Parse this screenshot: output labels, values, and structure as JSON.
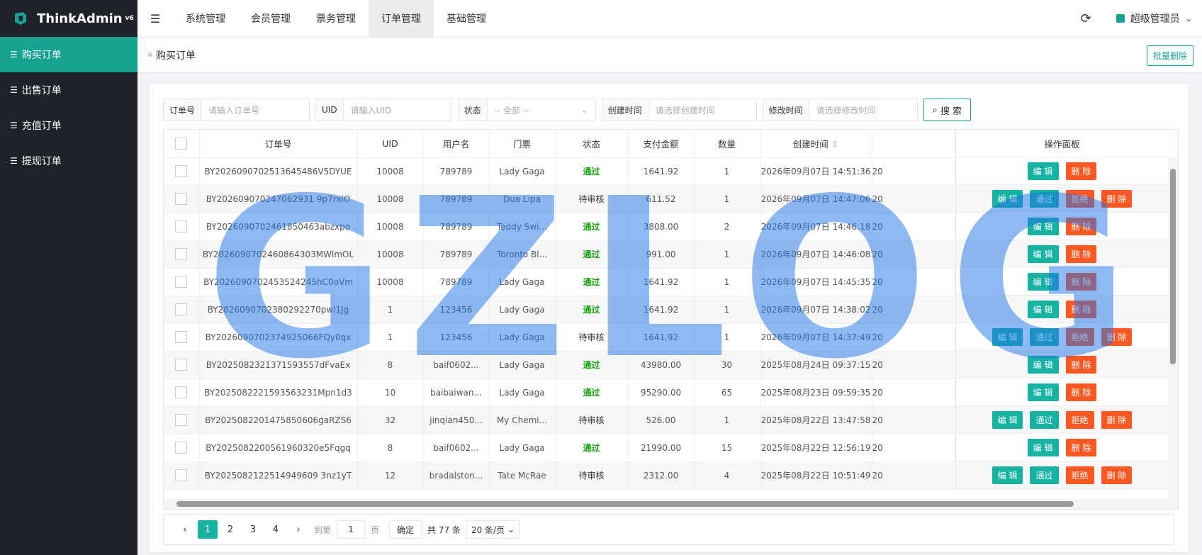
{
  "brand": {
    "name": "ThinkAdmin",
    "version": "v6"
  },
  "sidebar": {
    "items": [
      {
        "label": "购买订单",
        "active": true
      },
      {
        "label": "出售订单",
        "active": false
      },
      {
        "label": "充值订单",
        "active": false
      },
      {
        "label": "提现订单",
        "active": false
      }
    ]
  },
  "topnav": {
    "items": [
      {
        "label": "系统管理"
      },
      {
        "label": "会员管理"
      },
      {
        "label": "票务管理"
      },
      {
        "label": "订单管理",
        "active": true
      },
      {
        "label": "基础管理"
      }
    ],
    "user": "超级管理员"
  },
  "breadcrumb": {
    "title": "购买订单",
    "batch_delete": "批量删除"
  },
  "filters": {
    "order_no": {
      "label": "订单号",
      "placeholder": "请输入订单号"
    },
    "uid": {
      "label": "UID",
      "placeholder": "请输入UID"
    },
    "status": {
      "label": "状态",
      "value": "-- 全部 --"
    },
    "created": {
      "label": "创建时间",
      "placeholder": "请选择创建时间"
    },
    "modified": {
      "label": "修改时间",
      "placeholder": "请选择修改时间"
    },
    "search": "搜 索"
  },
  "table": {
    "headers": {
      "order_no": "订单号",
      "uid": "UID",
      "user": "用户名",
      "ticket": "门票",
      "status": "状态",
      "amount": "支付金额",
      "qty": "数量",
      "created": "创建时间",
      "ops": "操作面板"
    },
    "rows": [
      {
        "order_no": "BY2026090702513645486V5DYUE",
        "uid": "10008",
        "user": "789789",
        "ticket": "Lady Gaga",
        "status": "通过",
        "amount": "1641.92",
        "qty": "1",
        "created": "2026年09月07日 14:51:36",
        "more": "20"
      },
      {
        "order_no": "BY202609070247062931 9p7rxiO",
        "uid": "10008",
        "user": "789789",
        "ticket": "Dua Lipa",
        "status": "待审核",
        "amount": "611.52",
        "qty": "1",
        "created": "2026年09月07日 14:47:06",
        "more": "20"
      },
      {
        "order_no": "BY2026090702461850463abzxpo",
        "uid": "10008",
        "user": "789789",
        "ticket": "Teddy Swi...",
        "status": "通过",
        "amount": "3808.00",
        "qty": "2",
        "created": "2026年09月07日 14:46:18",
        "more": "20"
      },
      {
        "order_no": "BY2026090702460864303MWlmOL",
        "uid": "10008",
        "user": "789789",
        "ticket": "Toronto Bl...",
        "status": "通过",
        "amount": "991.00",
        "qty": "1",
        "created": "2026年09月07日 14:46:08",
        "more": "20"
      },
      {
        "order_no": "BY2026090702453524245hC0oVm",
        "uid": "10008",
        "user": "789789",
        "ticket": "Lady Gaga",
        "status": "通过",
        "amount": "1641.92",
        "qty": "1",
        "created": "2026年09月07日 14:45:35",
        "more": "20"
      },
      {
        "order_no": "BY2026090702380292270pwl1Jg",
        "uid": "1",
        "user": "123456",
        "ticket": "Lady Gaga",
        "status": "通过",
        "amount": "1641.92",
        "qty": "1",
        "created": "2026年09月07日 14:38:02",
        "more": "20"
      },
      {
        "order_no": "BY2026090702374925066FQy0qx",
        "uid": "1",
        "user": "123456",
        "ticket": "Lady Gaga",
        "status": "待审核",
        "amount": "1641.92",
        "qty": "1",
        "created": "2026年09月07日 14:37:49",
        "more": "20"
      },
      {
        "order_no": "BY2025082321371593557dFvaEx",
        "uid": "8",
        "user": "baif0602...",
        "ticket": "Lady Gaga",
        "status": "通过",
        "amount": "43980.00",
        "qty": "30",
        "created": "2025年08月24日 09:37:15",
        "more": "20"
      },
      {
        "order_no": "BY2025082221593563231Mpn1d3",
        "uid": "10",
        "user": "baibaiwan...",
        "ticket": "Lady Gaga",
        "status": "通过",
        "amount": "95290.00",
        "qty": "65",
        "created": "2025年08月23日 09:59:35",
        "more": "20"
      },
      {
        "order_no": "BY2025082201475850606gaRZS6",
        "uid": "32",
        "user": "jinqian450...",
        "ticket": "My Chemi...",
        "status": "待审核",
        "amount": "526.00",
        "qty": "1",
        "created": "2025年08月22日 13:47:58",
        "more": "20"
      },
      {
        "order_no": "BY2025082200561960320e5Fqgq",
        "uid": "8",
        "user": "baif0602...",
        "ticket": "Lady Gaga",
        "status": "通过",
        "amount": "21990.00",
        "qty": "15",
        "created": "2025年08月22日 12:56:19",
        "more": "20"
      },
      {
        "order_no": "BY2025082122514949609 3nz1yT",
        "uid": "12",
        "user": "bradalston...",
        "ticket": "Tate McRae",
        "status": "待审核",
        "amount": "2312.00",
        "qty": "4",
        "created": "2025年08月22日 10:51:49",
        "more": "20"
      }
    ]
  },
  "actions": {
    "edit": "编 辑",
    "pass": "通过",
    "reject": "拒绝",
    "delete": "删 除"
  },
  "pager": {
    "pages": [
      "1",
      "2",
      "3",
      "4"
    ],
    "goto": "到第",
    "page_input": "1",
    "page_unit": "页",
    "confirm": "确定",
    "total": "共 77 条",
    "size": "20 条/页"
  },
  "watermark": "GZLOG",
  "colors": {
    "accent": "#16a191",
    "pass": "#16a30d",
    "danger": "#ff5722"
  }
}
